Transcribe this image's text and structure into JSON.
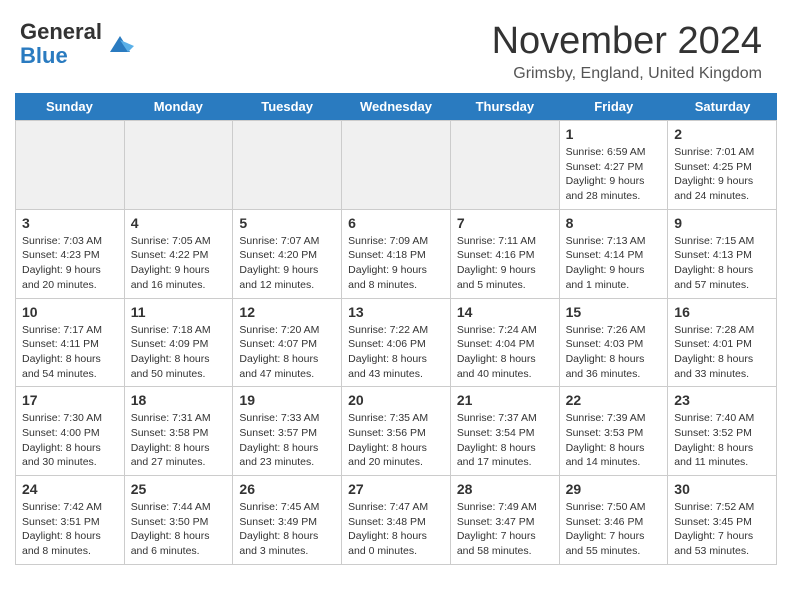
{
  "header": {
    "logo_general": "General",
    "logo_blue": "Blue",
    "title": "November 2024",
    "location": "Grimsby, England, United Kingdom"
  },
  "calendar": {
    "days_of_week": [
      "Sunday",
      "Monday",
      "Tuesday",
      "Wednesday",
      "Thursday",
      "Friday",
      "Saturday"
    ],
    "weeks": [
      [
        {
          "day": "",
          "info": "",
          "empty": true
        },
        {
          "day": "",
          "info": "",
          "empty": true
        },
        {
          "day": "",
          "info": "",
          "empty": true
        },
        {
          "day": "",
          "info": "",
          "empty": true
        },
        {
          "day": "",
          "info": "",
          "empty": true
        },
        {
          "day": "1",
          "info": "Sunrise: 6:59 AM\nSunset: 4:27 PM\nDaylight: 9 hours and 28 minutes.",
          "empty": false
        },
        {
          "day": "2",
          "info": "Sunrise: 7:01 AM\nSunset: 4:25 PM\nDaylight: 9 hours and 24 minutes.",
          "empty": false
        }
      ],
      [
        {
          "day": "3",
          "info": "Sunrise: 7:03 AM\nSunset: 4:23 PM\nDaylight: 9 hours and 20 minutes.",
          "empty": false
        },
        {
          "day": "4",
          "info": "Sunrise: 7:05 AM\nSunset: 4:22 PM\nDaylight: 9 hours and 16 minutes.",
          "empty": false
        },
        {
          "day": "5",
          "info": "Sunrise: 7:07 AM\nSunset: 4:20 PM\nDaylight: 9 hours and 12 minutes.",
          "empty": false
        },
        {
          "day": "6",
          "info": "Sunrise: 7:09 AM\nSunset: 4:18 PM\nDaylight: 9 hours and 8 minutes.",
          "empty": false
        },
        {
          "day": "7",
          "info": "Sunrise: 7:11 AM\nSunset: 4:16 PM\nDaylight: 9 hours and 5 minutes.",
          "empty": false
        },
        {
          "day": "8",
          "info": "Sunrise: 7:13 AM\nSunset: 4:14 PM\nDaylight: 9 hours and 1 minute.",
          "empty": false
        },
        {
          "day": "9",
          "info": "Sunrise: 7:15 AM\nSunset: 4:13 PM\nDaylight: 8 hours and 57 minutes.",
          "empty": false
        }
      ],
      [
        {
          "day": "10",
          "info": "Sunrise: 7:17 AM\nSunset: 4:11 PM\nDaylight: 8 hours and 54 minutes.",
          "empty": false
        },
        {
          "day": "11",
          "info": "Sunrise: 7:18 AM\nSunset: 4:09 PM\nDaylight: 8 hours and 50 minutes.",
          "empty": false
        },
        {
          "day": "12",
          "info": "Sunrise: 7:20 AM\nSunset: 4:07 PM\nDaylight: 8 hours and 47 minutes.",
          "empty": false
        },
        {
          "day": "13",
          "info": "Sunrise: 7:22 AM\nSunset: 4:06 PM\nDaylight: 8 hours and 43 minutes.",
          "empty": false
        },
        {
          "day": "14",
          "info": "Sunrise: 7:24 AM\nSunset: 4:04 PM\nDaylight: 8 hours and 40 minutes.",
          "empty": false
        },
        {
          "day": "15",
          "info": "Sunrise: 7:26 AM\nSunset: 4:03 PM\nDaylight: 8 hours and 36 minutes.",
          "empty": false
        },
        {
          "day": "16",
          "info": "Sunrise: 7:28 AM\nSunset: 4:01 PM\nDaylight: 8 hours and 33 minutes.",
          "empty": false
        }
      ],
      [
        {
          "day": "17",
          "info": "Sunrise: 7:30 AM\nSunset: 4:00 PM\nDaylight: 8 hours and 30 minutes.",
          "empty": false
        },
        {
          "day": "18",
          "info": "Sunrise: 7:31 AM\nSunset: 3:58 PM\nDaylight: 8 hours and 27 minutes.",
          "empty": false
        },
        {
          "day": "19",
          "info": "Sunrise: 7:33 AM\nSunset: 3:57 PM\nDaylight: 8 hours and 23 minutes.",
          "empty": false
        },
        {
          "day": "20",
          "info": "Sunrise: 7:35 AM\nSunset: 3:56 PM\nDaylight: 8 hours and 20 minutes.",
          "empty": false
        },
        {
          "day": "21",
          "info": "Sunrise: 7:37 AM\nSunset: 3:54 PM\nDaylight: 8 hours and 17 minutes.",
          "empty": false
        },
        {
          "day": "22",
          "info": "Sunrise: 7:39 AM\nSunset: 3:53 PM\nDaylight: 8 hours and 14 minutes.",
          "empty": false
        },
        {
          "day": "23",
          "info": "Sunrise: 7:40 AM\nSunset: 3:52 PM\nDaylight: 8 hours and 11 minutes.",
          "empty": false
        }
      ],
      [
        {
          "day": "24",
          "info": "Sunrise: 7:42 AM\nSunset: 3:51 PM\nDaylight: 8 hours and 8 minutes.",
          "empty": false
        },
        {
          "day": "25",
          "info": "Sunrise: 7:44 AM\nSunset: 3:50 PM\nDaylight: 8 hours and 6 minutes.",
          "empty": false
        },
        {
          "day": "26",
          "info": "Sunrise: 7:45 AM\nSunset: 3:49 PM\nDaylight: 8 hours and 3 minutes.",
          "empty": false
        },
        {
          "day": "27",
          "info": "Sunrise: 7:47 AM\nSunset: 3:48 PM\nDaylight: 8 hours and 0 minutes.",
          "empty": false
        },
        {
          "day": "28",
          "info": "Sunrise: 7:49 AM\nSunset: 3:47 PM\nDaylight: 7 hours and 58 minutes.",
          "empty": false
        },
        {
          "day": "29",
          "info": "Sunrise: 7:50 AM\nSunset: 3:46 PM\nDaylight: 7 hours and 55 minutes.",
          "empty": false
        },
        {
          "day": "30",
          "info": "Sunrise: 7:52 AM\nSunset: 3:45 PM\nDaylight: 7 hours and 53 minutes.",
          "empty": false
        }
      ]
    ]
  }
}
